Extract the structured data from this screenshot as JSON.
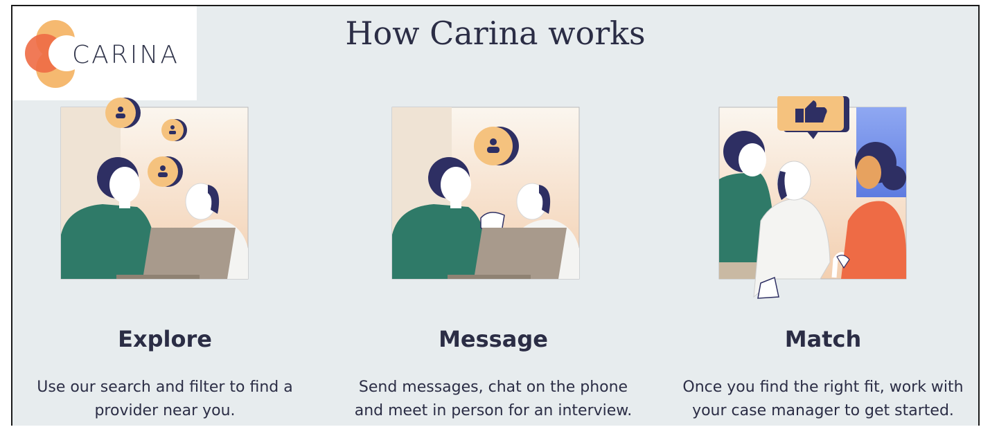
{
  "logo": {
    "text": "CARINA"
  },
  "page": {
    "title": "How Carina works"
  },
  "steps": [
    {
      "title": "Explore",
      "description_line1": "Use our search and filter to find a",
      "description_line2": "provider near you."
    },
    {
      "title": "Message",
      "description_line1": "Send messages, chat on the phone",
      "description_line2": "and meet in person for an interview."
    },
    {
      "title": "Match",
      "description_line1": "Once you find the right fit, work with",
      "description_line2": "your case manager to get started."
    }
  ],
  "colors": {
    "background": "#e7ecee",
    "text": "#2b2d45",
    "brand_orange": "#ee6b45",
    "brand_peach": "#f5b970",
    "teal_shirt": "#2f7a68",
    "hair_navy": "#2e2f63"
  },
  "icons": [
    "carina-logo-icon",
    "person-bubble-icon",
    "thumbs-up-icon"
  ]
}
